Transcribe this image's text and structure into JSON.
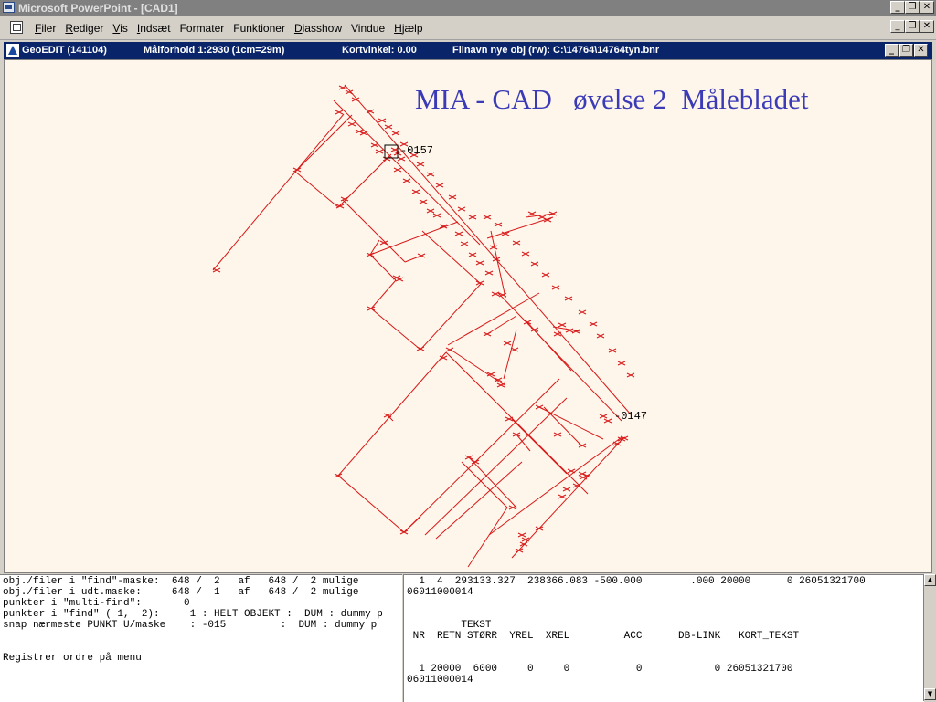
{
  "app": {
    "title": "Microsoft PowerPoint - [CAD1]",
    "caption_min": "_",
    "caption_restore": "❐",
    "caption_close": "✕"
  },
  "menu": {
    "items": [
      {
        "accel": "F",
        "rest": "iler"
      },
      {
        "accel": "R",
        "rest": "ediger"
      },
      {
        "accel": "V",
        "rest": "is"
      },
      {
        "accel": "I",
        "rest": "ndsæt"
      },
      {
        "accel": "",
        "rest": "Formater"
      },
      {
        "accel": "",
        "rest": "Funktioner"
      },
      {
        "accel": "D",
        "rest": "iasshow"
      },
      {
        "accel": "",
        "rest": "Vindue"
      },
      {
        "accel": "H",
        "rest": "jælp"
      }
    ]
  },
  "geoedit": {
    "title": "GeoEDIT  (141104)",
    "scale": "Målforhold  1:2930   (1cm=29m)",
    "angle": "Kortvinkel:    0.00",
    "file": "Filnavn nye obj  (rw):  C:\\14764\\14764tyn.bnr"
  },
  "canvas": {
    "slide_title": "MIA - CAD   øvelse 2  Målebladet",
    "label_157": "-0157",
    "label_147": "-0147",
    "line_color": "#d81818",
    "title_color": "#3b3bb7"
  },
  "console_left": {
    "lines": [
      "obj./filer i \"find\"-maske:  648 /  2   af   648 /  2 mulige",
      "obj./filer i udt.maske:     648 /  1   af   648 /  2 mulige",
      "punkter i \"multi-find\":       0",
      "punkter i \"find\" ( 1,  2):     1 : HELT OBJEKT :  DUM : dummy p",
      "snap nærmeste PUNKT U/maske    : -015         :  DUM : dummy p",
      "",
      "",
      "Registrer ordre på menu"
    ]
  },
  "console_right": {
    "lines": [
      "  1  4  293133.327  238366.083 -500.000        .000 20000      0 26051321700",
      "06011000014",
      "",
      "",
      "         TEKST",
      " NR  RETN STØRR  YREL  XREL         ACC      DB-LINK   KORT_TEKST",
      "",
      "",
      "  1 20000  6000     0     0           0            0 26051321700",
      "06011000014"
    ]
  }
}
